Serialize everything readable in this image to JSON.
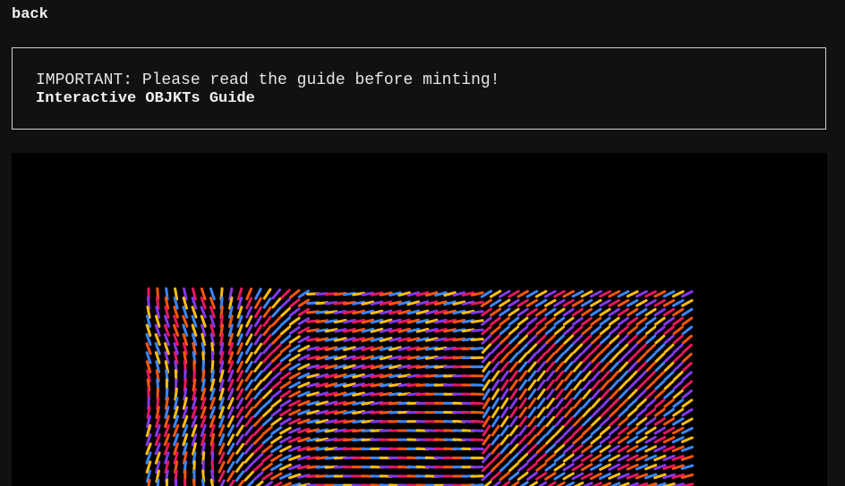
{
  "nav": {
    "back_label": "back"
  },
  "notice": {
    "text": "IMPORTANT: Please read the guide before minting!",
    "link_label": "Interactive OBJKTs Guide"
  },
  "artwork": {
    "background": "#000000",
    "palette": [
      "#e8175d",
      "#3a86ff",
      "#8338ec",
      "#fb5607",
      "#ffbe0b"
    ]
  }
}
